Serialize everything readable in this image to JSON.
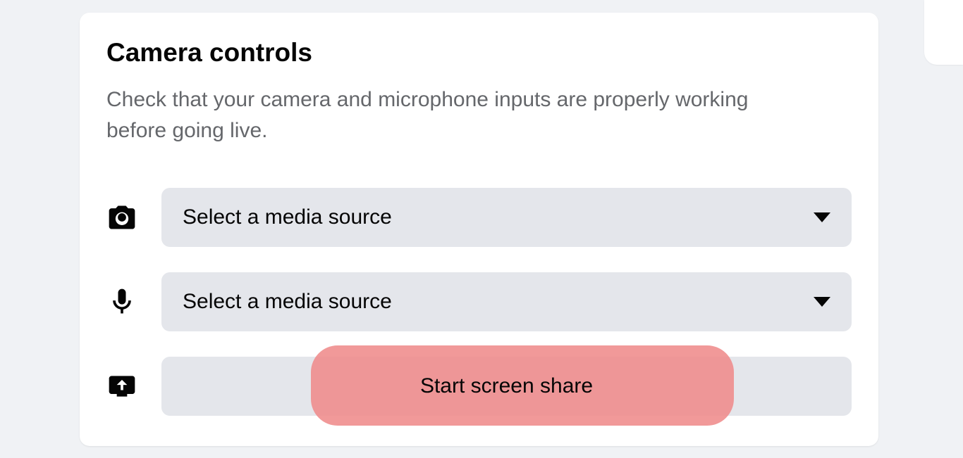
{
  "card": {
    "title": "Camera controls",
    "description": "Check that your camera and microphone inputs are properly working before going live.",
    "camera": {
      "placeholder": "Select a media source"
    },
    "microphone": {
      "placeholder": "Select a media source"
    },
    "screenshare": {
      "label": "Start screen share"
    }
  }
}
